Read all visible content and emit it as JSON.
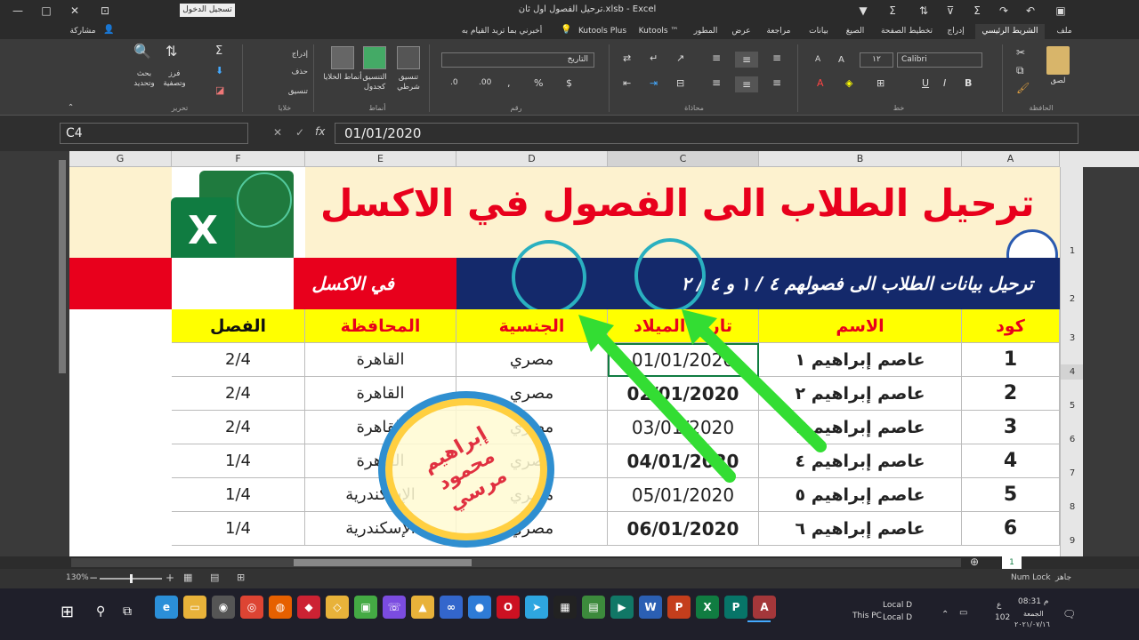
{
  "window": {
    "title": "ترحيل الفصول اول ثان.xlsb - Excel",
    "signin_button": "تسجيل الدخول"
  },
  "ribbon_tabs": [
    "ملف",
    "الشريط الرئيسي",
    "إدراج",
    "تخطيط الصفحة",
    "الصيغ",
    "بيانات",
    "مراجعة",
    "عرض",
    "المطور",
    "Kutools ™",
    "Kutools Plus"
  ],
  "tell_me": "أخبرني بما تريد القيام به",
  "share": "مشاركة",
  "ribbon": {
    "clipboard": {
      "label": "الحافظة",
      "paste": "لصق"
    },
    "font": {
      "label": "خط",
      "name": "Calibri",
      "size": "١٢"
    },
    "alignment": {
      "label": "محاذاة"
    },
    "number": {
      "label": "رقم",
      "format": "التاريخ"
    },
    "styles": {
      "label": "أنماط",
      "conditional": "تنسيق شرطي",
      "as_table": "التنسيق كجدول",
      "cell_styles": "أنماط الخلايا"
    },
    "cells": {
      "label": "خلايا",
      "insert": "إدراج",
      "delete": "حذف",
      "format": "تنسيق"
    },
    "editing": {
      "label": "تحرير",
      "sort": "فرز وتصفية",
      "find": "بحث وتحديد"
    }
  },
  "formula_bar": {
    "name_box": "C4",
    "formula": "01/01/2020"
  },
  "columns": [
    "G",
    "F",
    "E",
    "D",
    "C",
    "B",
    "A"
  ],
  "rows": [
    "1",
    "2",
    "3",
    "4",
    "5",
    "6",
    "7",
    "8",
    "9"
  ],
  "sheet": {
    "title": "ترحيل الطلاب الى الفصول في الاكسل",
    "subtitle": "ترحيل بيانات الطلاب الى فصولهم ٤ / ١ و ٤ / ٢",
    "subtitle_left": "في الاكسل",
    "excel_logo": "X",
    "headers": [
      "كود",
      "الاسم",
      "تاريخ الميلاد",
      "الجنسية",
      "المحافظة",
      "الفصل"
    ],
    "data_rows": [
      [
        "1",
        "عاصم إبراهيم ١",
        "01/01/2020",
        "مصري",
        "القاهرة",
        "2/4"
      ],
      [
        "2",
        "عاصم إبراهيم ٢",
        "02/01/2020",
        "مصري",
        "القاهرة",
        "2/4"
      ],
      [
        "3",
        "عاصم إبراهيم ٣",
        "03/01/2020",
        "مصري",
        "القاهرة",
        "2/4"
      ],
      [
        "4",
        "عاصم إبراهيم ٤",
        "04/01/2020",
        "مصري",
        "القاهرة",
        "1/4"
      ],
      [
        "5",
        "عاصم إبراهيم ٥",
        "05/01/2020",
        "مصري",
        "الإسكندرية",
        "1/4"
      ],
      [
        "6",
        "عاصم إبراهيم ٦",
        "06/01/2020",
        "مصري",
        "الإسكندرية",
        "1/4"
      ]
    ],
    "bold_dates": [
      false,
      true,
      false,
      true,
      false,
      true
    ],
    "stamp_text": "إبراهيم محمود مرسي"
  },
  "sheet_tab": "1",
  "status": {
    "ready": "جاهز",
    "numlock": "Num Lock",
    "zoom": "130%"
  },
  "taskbar": {
    "this_pc": "This PC",
    "drive1": "Local D",
    "drive2": "Local D",
    "time": "08:31 م",
    "day": "الجمعة",
    "date": "٢٠٢١/٠٧/١٦",
    "notif": "102",
    "lang": "ع"
  },
  "colors": {
    "title_red": "#e8001c",
    "header_yellow": "#ffff00",
    "navy": "#14296b",
    "arrow_green": "#33dd33",
    "circle_teal": "#2ab0c0",
    "cream": "#fdf2cf"
  }
}
